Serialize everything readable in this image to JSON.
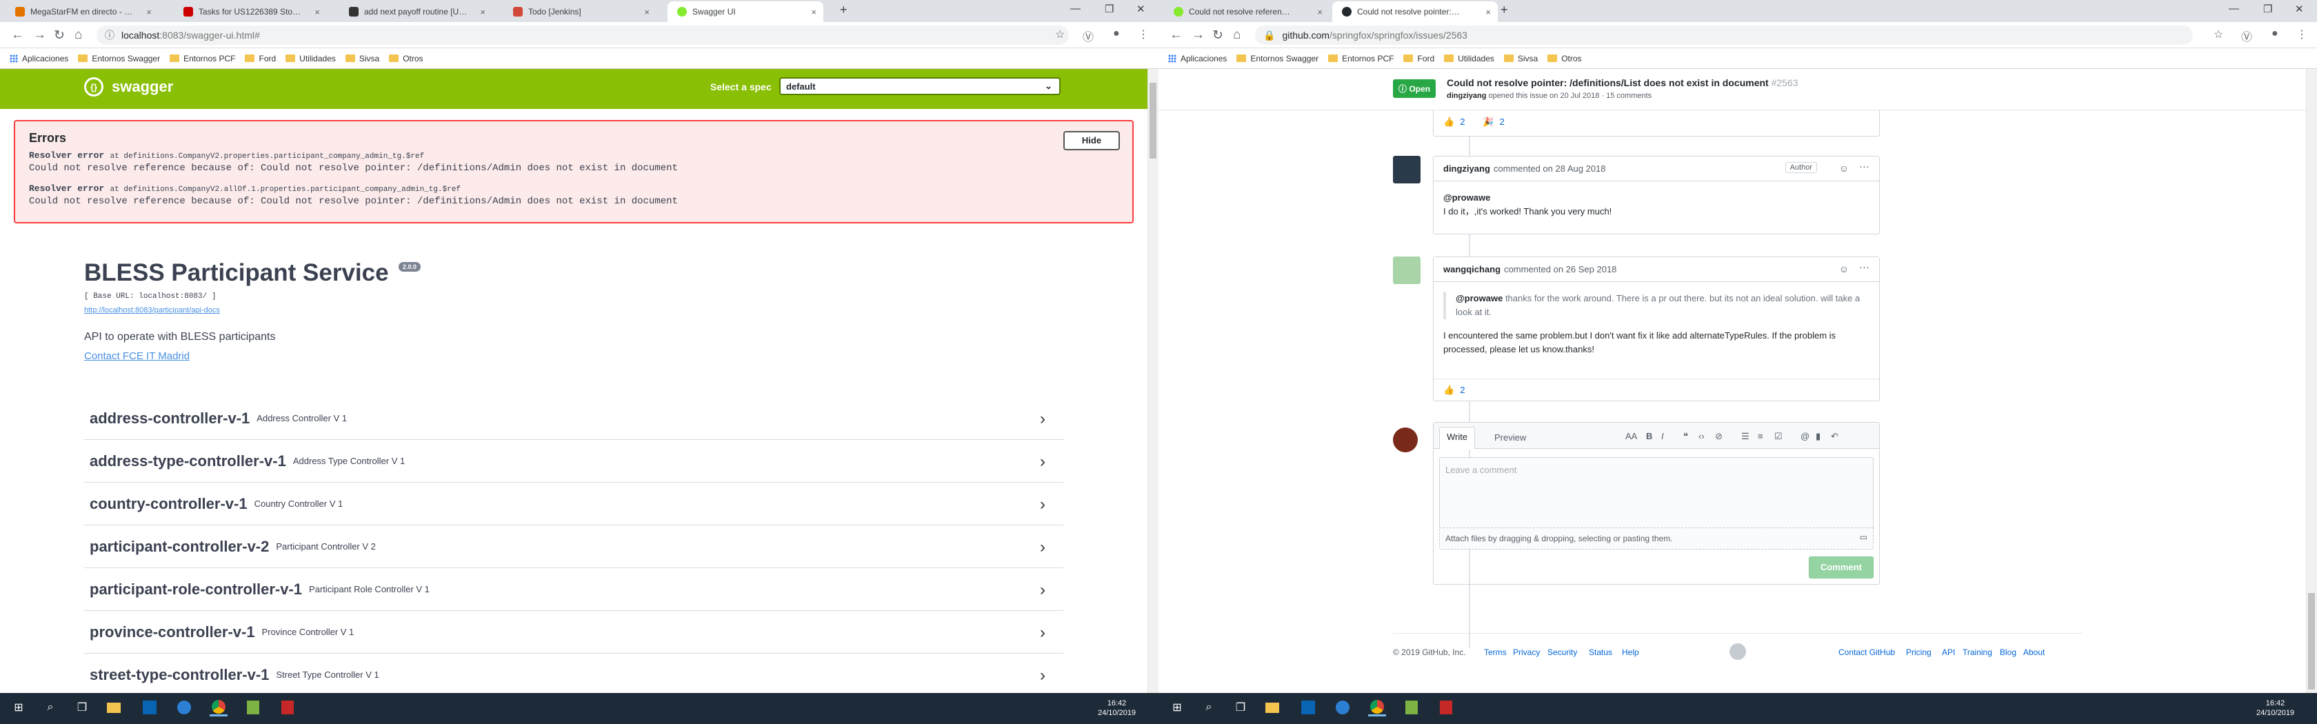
{
  "left_window": {
    "tabs": [
      {
        "title": "MegaStarFM en directo - En",
        "color": "#e37400"
      },
      {
        "title": "Tasks for US1226389 Stop/Start",
        "color": "#c00"
      },
      {
        "title": "add next payoff routine [US113",
        "color": "#333"
      },
      {
        "title": "Todo [Jenkins]",
        "color": "#d24939"
      },
      {
        "title": "Swagger UI",
        "color": "#85ea2d"
      }
    ],
    "url_host": "localhost",
    "url_path": ":8083/swagger-ui.html#",
    "bookmarks": [
      "Aplicaciones",
      "Entornos Swagger",
      "Entornos PCF",
      "Ford",
      "Utilidades",
      "Sivsa",
      "Otros"
    ],
    "swagger": {
      "logo": "swagger",
      "spec_label": "Select a spec",
      "spec_value": "default",
      "errors_title": "Errors",
      "hide_label": "Hide",
      "errors": [
        {
          "kind": "Resolver error",
          "at": "at definitions.CompanyV2.properties.participant_company_admin_tg.$ref",
          "message": "Could not resolve reference because of: Could not resolve pointer: /definitions/Admin does not exist in document"
        },
        {
          "kind": "Resolver error",
          "at": "at definitions.CompanyV2.allOf.1.properties.participant_company_admin_tg.$ref",
          "message": "Could not resolve reference because of: Could not resolve pointer: /definitions/Admin does not exist in document"
        }
      ],
      "title": "BLESS Participant Service",
      "version": "2.0.0",
      "base_url": "[ Base URL: localhost:8083/ ]",
      "docs_url": "http://localhost:8083/participant/api-docs",
      "description": "API to operate with BLESS participants",
      "contact": "Contact FCE IT Madrid",
      "controllers": [
        {
          "name": "address-controller-v-1",
          "desc": "Address Controller V 1"
        },
        {
          "name": "address-type-controller-v-1",
          "desc": "Address Type Controller V 1"
        },
        {
          "name": "country-controller-v-1",
          "desc": "Country Controller V 1"
        },
        {
          "name": "participant-controller-v-2",
          "desc": "Participant Controller V 2"
        },
        {
          "name": "participant-role-controller-v-1",
          "desc": "Participant Role Controller V 1"
        },
        {
          "name": "province-controller-v-1",
          "desc": "Province Controller V 1"
        },
        {
          "name": "street-type-controller-v-1",
          "desc": "Street Type Controller V 1"
        }
      ]
    }
  },
  "right_window": {
    "tabs": [
      {
        "title": "Could not resolve reference bec",
        "color": "#85ea2d"
      },
      {
        "title": "Could not resolve pointer: /defi",
        "color": "#24292e"
      }
    ],
    "url_host": "github.com",
    "url_path": "/springfox/springfox/issues/2563",
    "bookmarks": [
      "Aplicaciones",
      "Entornos Swagger",
      "Entornos PCF",
      "Ford",
      "Utilidades",
      "Sivsa",
      "Otros"
    ],
    "issue": {
      "state": "Open",
      "title": "Could not resolve pointer: /definitions/List does not exist in document",
      "number": "#2563",
      "author": "dingziyang",
      "subtitle": "opened this issue on 20 Jul 2018 · 15 comments",
      "top_reactions": [
        {
          "icon": "👍",
          "count": "2"
        },
        {
          "icon": "🎉",
          "count": "2"
        }
      ],
      "comments": [
        {
          "user": "dingziyang",
          "meta": "commented on 28 Aug 2018",
          "badge": "Author",
          "mention": "@prowawe",
          "text": "I do it，,it's worked! Thank you very much!"
        },
        {
          "user": "wangqichang",
          "meta": "commented on 26 Sep 2018",
          "mention": "@prowawe",
          "quote": "thanks for the work around. There is a pr out there. but its not an ideal solution. will take a look at it.",
          "text": "I encountered the same problem.but I don't want fix it like add alternateTypeRules. If the problem is processed, please let us know.thanks!",
          "reaction": {
            "icon": "👍",
            "count": "2"
          }
        }
      ],
      "editor": {
        "write": "Write",
        "preview": "Preview",
        "placeholder": "Leave a comment",
        "attach": "Attach files by dragging & dropping, selecting or pasting them.",
        "submit": "Comment"
      },
      "footer": {
        "copyright": "© 2019 GitHub, Inc.",
        "links_left": [
          "Terms",
          "Privacy",
          "Security",
          "Status",
          "Help"
        ],
        "links_right": [
          "Contact GitHub",
          "Pricing",
          "API",
          "Training",
          "Blog",
          "About"
        ]
      }
    }
  },
  "taskbar": {
    "left_time": "16:42",
    "left_date": "24/10/2019",
    "right_time": "16:42",
    "right_date": "24/10/2019"
  }
}
